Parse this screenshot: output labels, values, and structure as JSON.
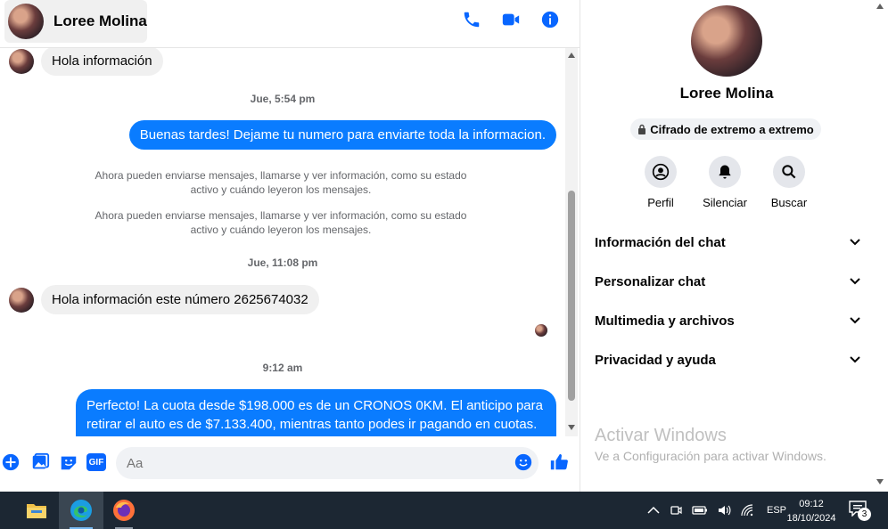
{
  "header": {
    "contact_name": "Loree Molina",
    "actions": [
      "phone-icon",
      "video-icon",
      "info-icon"
    ]
  },
  "messages": {
    "first_in": "Hola información",
    "ts1": "Jue, 5:54 pm",
    "out1": "Buenas tardes! Dejame tu numero para enviarte toda la informacion.",
    "sys1_line1": "Ahora pueden enviarse mensajes, llamarse y ver información, como su estado",
    "sys1_line2": "activo y cuándo leyeron los mensajes.",
    "sys2_line1": "Ahora pueden enviarse mensajes, llamarse y ver información, como su estado",
    "sys2_line2": "activo y cuándo leyeron los mensajes.",
    "ts2": "Jue, 11:08 pm",
    "in2": "Hola información este número 2625674032",
    "ts3": "9:12 am",
    "out2_line1": "Perfecto! La cuota desde $198.000 es de un CRONOS 0KM. El anticipo para",
    "out2_line2": "retirar el auto es de $7.133.400, mientras tanto podes ir pagando en cuotas."
  },
  "composer": {
    "placeholder": "Aa",
    "gif_label": "GIF"
  },
  "sidebar": {
    "name": "Loree Molina",
    "encryption": "Cifrado de extremo a extremo",
    "actions": [
      {
        "label": "Perfil",
        "icon": "profile-icon"
      },
      {
        "label": "Silenciar",
        "icon": "bell-icon"
      },
      {
        "label": "Buscar",
        "icon": "search-icon"
      }
    ],
    "sections": [
      "Información del chat",
      "Personalizar chat",
      "Multimedia y archivos",
      "Privacidad y ayuda"
    ],
    "activate_title": "Activar Windows",
    "activate_sub": "Ve a Configuración para activar Windows."
  },
  "taskbar": {
    "language": "ESP",
    "time": "09:12",
    "date": "18/10/2024",
    "notifications": "3"
  },
  "colors": {
    "accent": "#0a7cff",
    "icon_blue": "#0866ff",
    "taskbar": "#1c2733"
  }
}
